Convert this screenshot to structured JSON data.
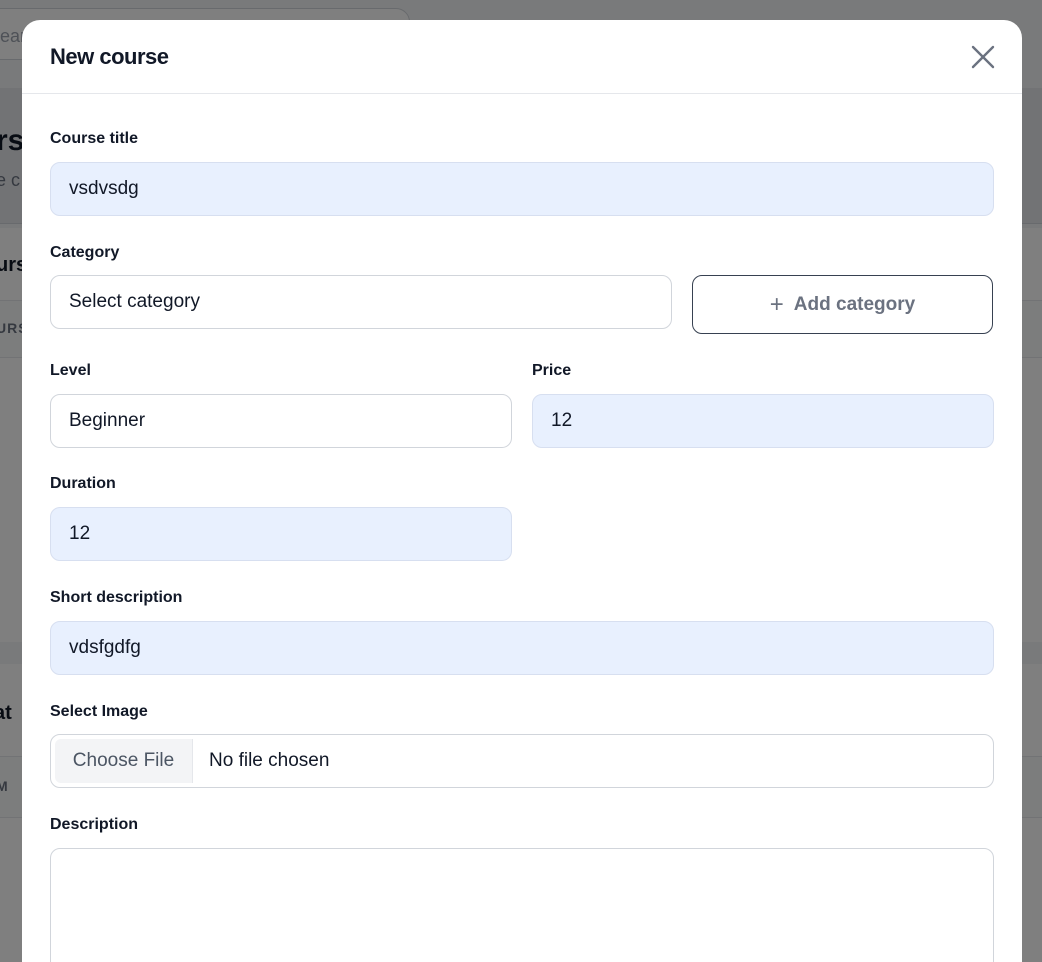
{
  "background": {
    "search_fragment": "ear",
    "title_fragment": "rs",
    "subtitle_fragment": "e c",
    "card1_title_fragment": "urs",
    "card1_col_fragment": "URS",
    "card2_title_fragment": "at",
    "card2_col_fragment": "M"
  },
  "modal": {
    "title": "New course",
    "close_label": "Close",
    "fields": {
      "course_title": {
        "label": "Course title",
        "value": "vsdvsdg"
      },
      "category": {
        "label": "Category",
        "value": "Select category",
        "add_label": "Add category"
      },
      "level": {
        "label": "Level",
        "value": "Beginner"
      },
      "price": {
        "label": "Price",
        "value": "12"
      },
      "duration": {
        "label": "Duration",
        "value": "12"
      },
      "short_description": {
        "label": "Short description",
        "value": "vdsfgdfg"
      },
      "image": {
        "label": "Select Image",
        "button": "Choose File",
        "status": "No file chosen"
      },
      "description": {
        "label": "Description",
        "value": ""
      }
    }
  },
  "colors": {
    "filled_input_bg": "#e8f0fe",
    "border": "#d1d5db",
    "text": "#111827",
    "muted": "#6b7280"
  }
}
